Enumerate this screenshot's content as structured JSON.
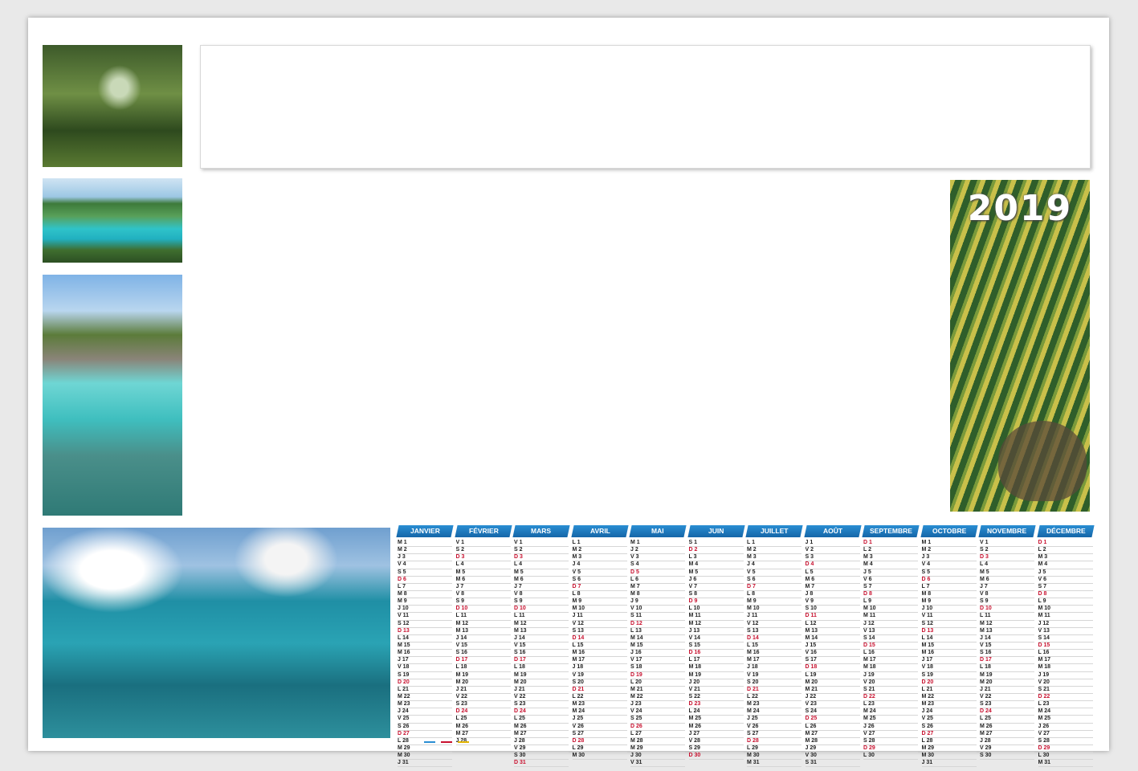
{
  "year": "2019",
  "months": [
    {
      "name": "JANVIER",
      "len": 31,
      "start": 2
    },
    {
      "name": "FÉVRIER",
      "len": 28,
      "start": 5
    },
    {
      "name": "MARS",
      "len": 31,
      "start": 5
    },
    {
      "name": "AVRIL",
      "len": 30,
      "start": 1
    },
    {
      "name": "MAI",
      "len": 31,
      "start": 3
    },
    {
      "name": "JUIN",
      "len": 30,
      "start": 6
    },
    {
      "name": "JUILLET",
      "len": 31,
      "start": 1
    },
    {
      "name": "AOÛT",
      "len": 31,
      "start": 4
    },
    {
      "name": "SEPTEMBRE",
      "len": 30,
      "start": 0
    },
    {
      "name": "OCTOBRE",
      "len": 31,
      "start": 2
    },
    {
      "name": "NOVEMBRE",
      "len": 30,
      "start": 5
    },
    {
      "name": "DÉCEMBRE",
      "len": 31,
      "start": 0
    }
  ],
  "day_letters": [
    "D",
    "L",
    "M",
    "M",
    "J",
    "V",
    "S"
  ],
  "colors": {
    "header_blue": "#1f7cc4",
    "sunday_red": "#c8102e",
    "zone_a": "#2a8ed3",
    "zone_b": "#c8102e",
    "zone_c": "#e2b400"
  }
}
